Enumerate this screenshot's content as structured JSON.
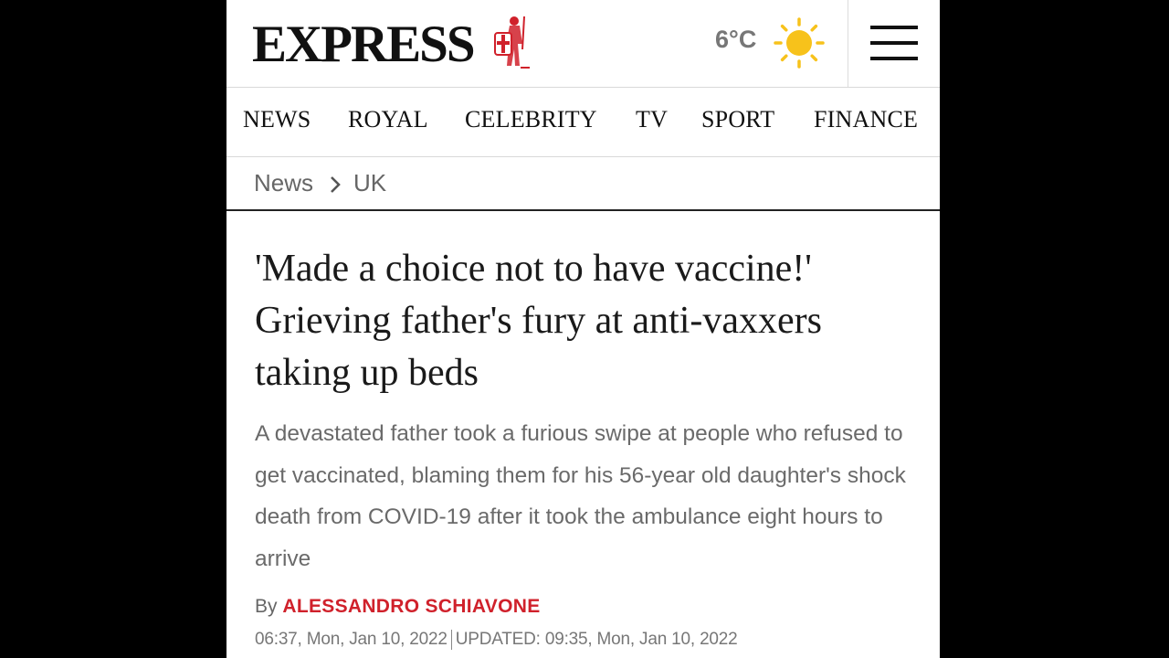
{
  "header": {
    "logo_text": "EXPRESS",
    "logo_emblem": "crusader-knight-icon",
    "weather": {
      "temperature": "6°C",
      "icon": "sun-icon",
      "icon_color": "#f7c21b"
    },
    "menu_icon": "hamburger-menu-icon"
  },
  "nav": {
    "items": [
      {
        "label": "NEWS"
      },
      {
        "label": "ROYAL"
      },
      {
        "label": "CELEBRITY"
      },
      {
        "label": "TV"
      },
      {
        "label": "SPORT"
      },
      {
        "label": "FINANCE"
      }
    ]
  },
  "breadcrumb": {
    "items": [
      {
        "label": "News"
      },
      {
        "label": "UK"
      }
    ],
    "separator_icon": "chevron-right-icon"
  },
  "article": {
    "headline": "'Made a choice not to have vaccine!' Grieving father's fury at anti-vaxxers taking up beds",
    "standfirst": "A devastated father took a furious swipe at people who refused to get vaccinated, blaming them for his 56-year old daughter's shock death from COVID-19 after it took the ambulance eight hours to arrive",
    "byline_prefix": "By",
    "author": "ALESSANDRO SCHIAVONE",
    "author_color": "#d0212b",
    "published": "06:37, Mon, Jan 10, 2022",
    "updated": "UPDATED: 09:35, Mon, Jan 10, 2022"
  }
}
